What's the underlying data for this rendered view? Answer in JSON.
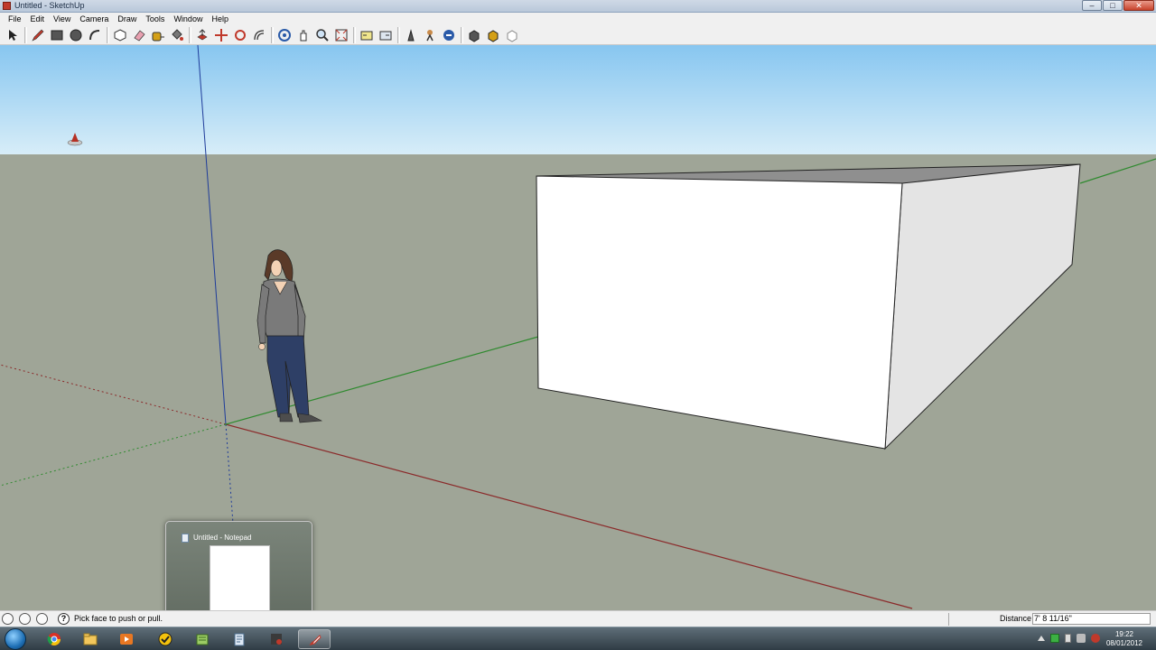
{
  "window": {
    "title": "Untitled - SketchUp",
    "minimize": "–",
    "maximize": "□",
    "close": "✕"
  },
  "menu": [
    "File",
    "Edit",
    "View",
    "Camera",
    "Draw",
    "Tools",
    "Window",
    "Help"
  ],
  "toolbar_icons": [
    "select-tool",
    "pencil-tool",
    "rectangle-tool",
    "circle-tool",
    "arc-tool",
    "make-component-tool",
    "eraser-tool",
    "tape-measure-tool",
    "paint-bucket-tool",
    "push-pull-tool",
    "move-tool",
    "rotate-tool",
    "offset-tool",
    "orbit-tool",
    "pan-tool",
    "zoom-tool",
    "zoom-extents-tool",
    "previous-view-tool",
    "next-view-tool",
    "position-camera-tool",
    "look-around-tool",
    "walk-tool",
    "get-models-tool",
    "share-model-tool",
    "3d-warehouse-tool",
    "extension-tool"
  ],
  "colors": {
    "sky_top": "#87c6f0",
    "sky_bottom": "#d7edf8",
    "ground": "#9fa597",
    "box_front": "#ffffff",
    "box_side": "#e4e4e4",
    "box_top": "#8f8f8f",
    "red_axis": "#8b2a2a",
    "green_axis": "#2f8a2f",
    "blue_axis": "#1f3c9a"
  },
  "notepad_thumbnail": {
    "title": "Untitled - Notepad"
  },
  "status": {
    "hint": "Pick face to push or pull.",
    "help_glyph": "?",
    "vcb_label": "Distance",
    "vcb_value": "7' 8 11/16\""
  },
  "taskbar": {
    "apps": [
      "chrome",
      "explorer",
      "media-player",
      "norton",
      "notepad",
      "notepad-2",
      "paint",
      "sketchup"
    ],
    "time": "19:22",
    "date": "08/01/2012"
  }
}
